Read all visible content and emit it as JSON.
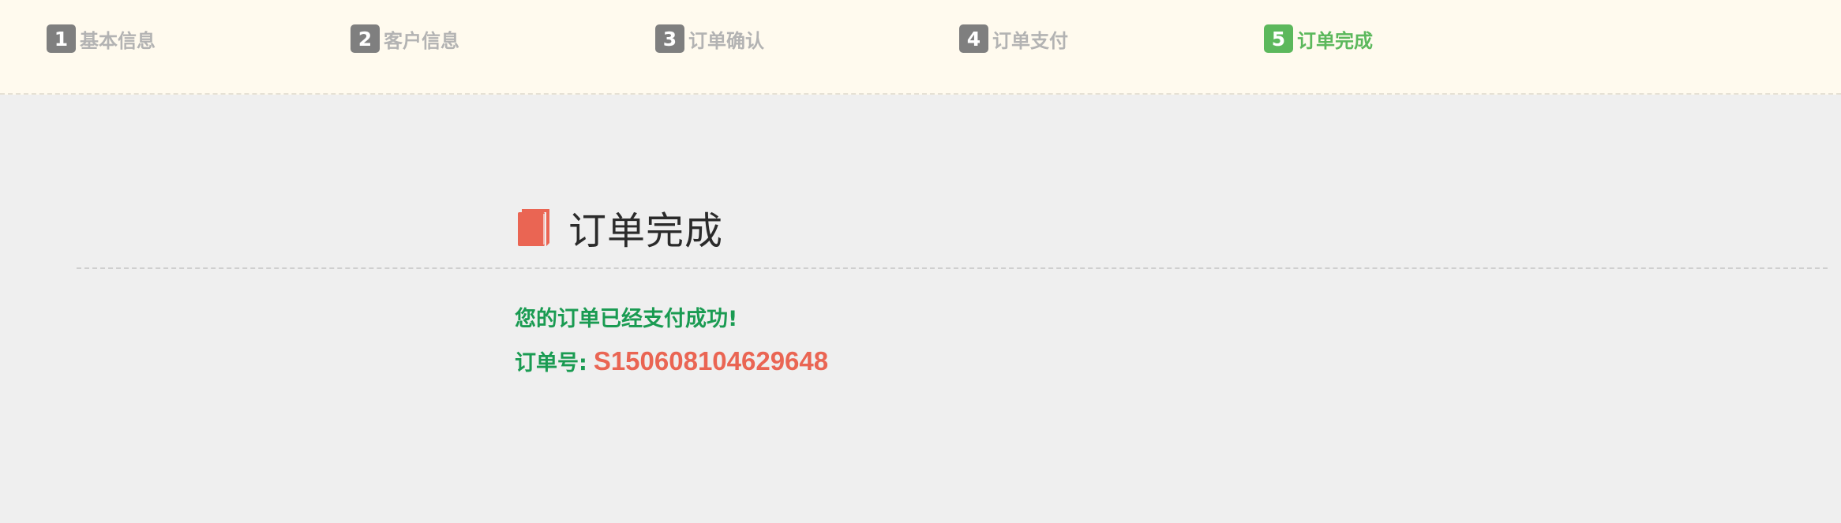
{
  "steps": [
    {
      "number": "1",
      "label": "基本信息",
      "active": false
    },
    {
      "number": "2",
      "label": "客户信息",
      "active": false
    },
    {
      "number": "3",
      "label": "订单确认",
      "active": false
    },
    {
      "number": "4",
      "label": "订单支付",
      "active": false
    },
    {
      "number": "5",
      "label": "订单完成",
      "active": true
    }
  ],
  "main": {
    "icon": "book-icon",
    "title": "订单完成",
    "success_message": "您的订单已经支付成功!",
    "order_label": "订单号:",
    "order_number": "S150608104629648"
  },
  "colors": {
    "header_bg": "#fffaee",
    "page_bg": "#efefef",
    "step_inactive": "#7f7f7f",
    "step_active": "#5cb85c",
    "success_text": "#1a9b52",
    "order_number": "#ea6553",
    "icon": "#ea6553"
  }
}
